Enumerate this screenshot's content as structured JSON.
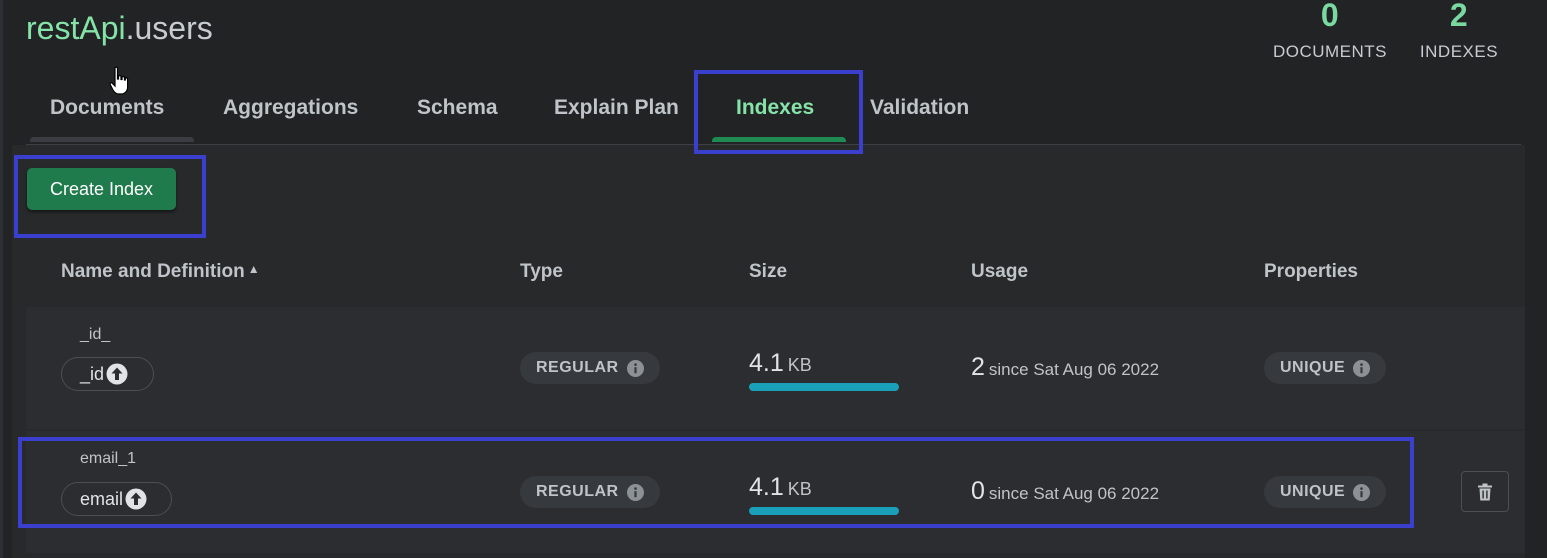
{
  "header": {
    "db_name": "restApi",
    "coll_name": ".users",
    "stats": {
      "documents": {
        "value": "0",
        "label": "DOCUMENTS"
      },
      "indexes": {
        "value": "2",
        "label": "INDEXES"
      }
    }
  },
  "tabs": [
    {
      "label": "Documents",
      "active": false
    },
    {
      "label": "Aggregations",
      "active": false
    },
    {
      "label": "Schema",
      "active": false
    },
    {
      "label": "Explain Plan",
      "active": false
    },
    {
      "label": "Indexes",
      "active": true
    },
    {
      "label": "Validation",
      "active": false
    }
  ],
  "toolbar": {
    "create_index_label": "Create Index"
  },
  "table": {
    "columns": [
      "Name and Definition",
      "Type",
      "Size",
      "Usage",
      "Properties"
    ],
    "sort_indicator": "▲",
    "rows": [
      {
        "name": "_id_",
        "key": "_id",
        "type": "REGULAR",
        "size_value": "4.1",
        "size_unit": "KB",
        "usage_count": "2",
        "usage_since": "since Sat Aug 06 2022",
        "property": "UNIQUE",
        "deletable": false
      },
      {
        "name": "email_1",
        "key": "email",
        "type": "REGULAR",
        "size_value": "4.1",
        "size_unit": "KB",
        "usage_count": "0",
        "usage_since": "since Sat Aug 06 2022",
        "property": "UNIQUE",
        "deletable": true
      }
    ]
  },
  "colors": {
    "background": "#212325",
    "accent_green": "#86e3a8",
    "button_green": "#1f7a4c",
    "size_bar": "#1aa0b8",
    "highlight_box": "#3b3fce"
  },
  "icons": [
    "pointer-cursor-icon",
    "sort-ascending-icon",
    "arrow-up-circle-icon",
    "info-icon",
    "trash-icon"
  ]
}
